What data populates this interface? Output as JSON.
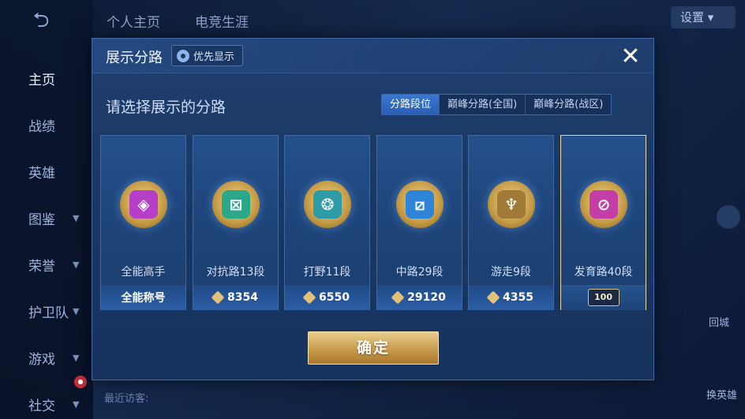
{
  "sidebar": {
    "items": [
      {
        "label": "主页",
        "active": true
      },
      {
        "label": "战绩"
      },
      {
        "label": "英雄"
      },
      {
        "label": "图鉴"
      },
      {
        "label": "荣誉"
      },
      {
        "label": "护卫队"
      },
      {
        "label": "游戏"
      },
      {
        "label": "社交"
      }
    ]
  },
  "top_tabs": [
    "个人主页",
    "电竞生涯"
  ],
  "top_right_label": "设置",
  "right_skill1": "回城",
  "right_skill2": "换英雄",
  "bottom_visitors": "最近访客:",
  "modal": {
    "title": "展示分路",
    "priority_label": "优先显示",
    "close_label": "✕",
    "subtitle": "请选择展示的分路",
    "segments": [
      {
        "label": "分路段位",
        "active": true
      },
      {
        "label": "巅峰分路(全国)"
      },
      {
        "label": "巅峰分路(战区)"
      }
    ],
    "cards": [
      {
        "name": "全能高手",
        "score_text": "全能称号",
        "has_diamond": false,
        "emblem_color": "#b63fc7",
        "emblem_glyph": "◈"
      },
      {
        "name": "对抗路13段",
        "score_text": "8354",
        "has_diamond": true,
        "emblem_color": "#2aa889",
        "emblem_glyph": "⊠"
      },
      {
        "name": "打野11段",
        "score_text": "6550",
        "has_diamond": true,
        "emblem_color": "#2e9ca6",
        "emblem_glyph": "❂"
      },
      {
        "name": "中路29段",
        "score_text": "29120",
        "has_diamond": true,
        "emblem_color": "#2d84d8",
        "emblem_glyph": "⧄"
      },
      {
        "name": "游走9段",
        "score_text": "4355",
        "has_diamond": true,
        "emblem_color": "#a07a36",
        "emblem_glyph": "♆"
      },
      {
        "name": "发育路40段",
        "score_text": "100",
        "has_diamond": false,
        "selected": true,
        "emblem_color": "#c43ea8",
        "emblem_glyph": "⊘"
      }
    ],
    "confirm_label": "确定"
  },
  "colors": {
    "accent_blue": "#2a5fb3",
    "confirm_gold": "#c99b4c",
    "selected_border": "#e8d9a5"
  }
}
